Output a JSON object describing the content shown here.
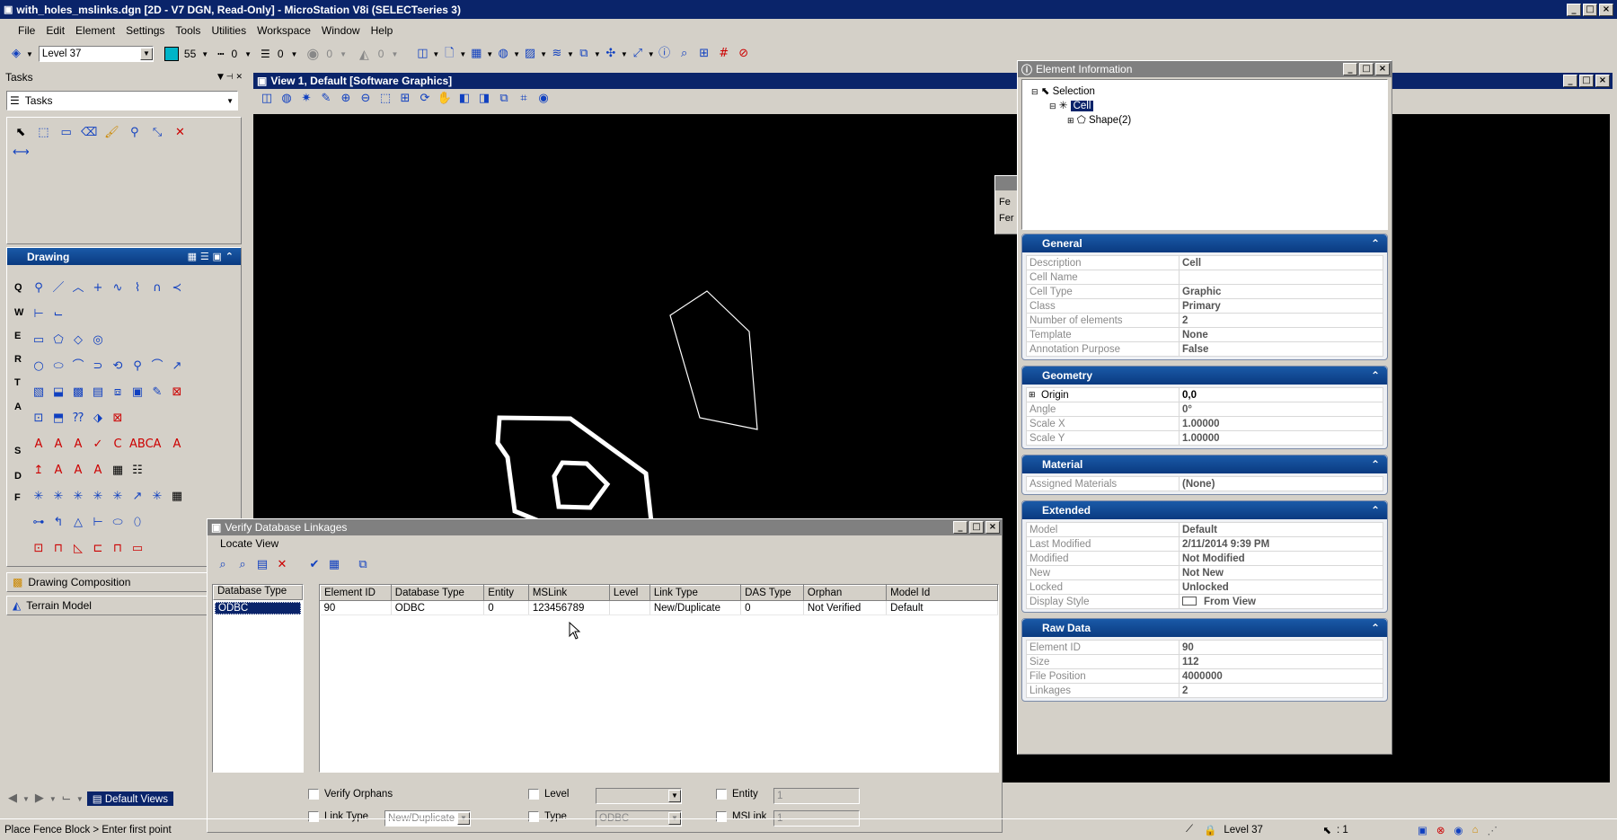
{
  "app": {
    "title": "with_holes_mslinks.dgn [2D - V7 DGN, Read-Only] - MicroStation V8i (SELECTseries 3)"
  },
  "menu": [
    "File",
    "Edit",
    "Element",
    "Settings",
    "Tools",
    "Utilities",
    "Workspace",
    "Window",
    "Help"
  ],
  "attributes": {
    "level": "Level 37",
    "color": "55",
    "style": "0",
    "weight": "0",
    "transp": "0",
    "priority": "0",
    "color_hex": "#00b4c8"
  },
  "tasks": {
    "title": "Tasks",
    "dropdown": "Tasks",
    "drawing_title": "Drawing",
    "drawing_comp": "Drawing Composition",
    "terrain": "Terrain Model",
    "row_letters": [
      "Q",
      "W",
      "E",
      "R",
      "T",
      "A",
      "S",
      "D",
      "F"
    ],
    "default_views": "Default Views"
  },
  "view": {
    "title": "View 1, Default [Software Graphics]"
  },
  "info": {
    "title": "Element Information",
    "tree": {
      "root": "Selection",
      "cell": "Cell",
      "shape": "Shape(2)"
    },
    "sections": [
      {
        "name": "General",
        "rows": [
          [
            "Description",
            "Cell"
          ],
          [
            "Cell Name",
            ""
          ],
          [
            "Cell Type",
            "Graphic"
          ],
          [
            "Class",
            "Primary"
          ],
          [
            "Number of elements",
            "2"
          ],
          [
            "Template",
            "None"
          ],
          [
            "Annotation Purpose",
            "False"
          ]
        ]
      },
      {
        "name": "Geometry",
        "rows": [
          [
            "Origin",
            "0,0"
          ],
          [
            "Angle",
            "0°"
          ],
          [
            "Scale X",
            "1.00000"
          ],
          [
            "Scale Y",
            "1.00000"
          ]
        ]
      },
      {
        "name": "Material",
        "rows": [
          [
            "Assigned Materials",
            "(None)"
          ]
        ]
      },
      {
        "name": "Extended",
        "rows": [
          [
            "Model",
            "Default"
          ],
          [
            "Last Modified",
            "2/11/2014 9:39 PM"
          ],
          [
            "Modified",
            "Not Modified"
          ],
          [
            "New",
            "Not New"
          ],
          [
            "Locked",
            "Unlocked"
          ],
          [
            "Display Style",
            "From View"
          ]
        ]
      },
      {
        "name": "Raw Data",
        "rows": [
          [
            "Element ID",
            "90"
          ],
          [
            "Size",
            "112"
          ],
          [
            "File Position",
            "4000000"
          ],
          [
            "Linkages",
            "2"
          ]
        ]
      }
    ]
  },
  "behind": {
    "l1": "Fe",
    "l2": "Fer"
  },
  "verify": {
    "title": "Verify Database Linkages",
    "menu": "Locate View",
    "left_header": "Database Type",
    "left_item": "ODBC",
    "columns": [
      "Element ID",
      "Database Type",
      "Entity",
      "MSLink",
      "Level",
      "Link Type",
      "DAS Type",
      "Orphan",
      "Model Id"
    ],
    "rows": [
      [
        "90",
        "ODBC",
        "0",
        "123456789",
        "",
        "New/Duplicate",
        "0",
        "Not Verified",
        "Default"
      ]
    ],
    "opts": {
      "verify_orphans": "Verify Orphans",
      "link_type": "Link Type",
      "link_type_val": "New/Duplicate",
      "level": "Level",
      "level_val": "",
      "type": "Type",
      "type_val": "ODBC",
      "entity": "Entity",
      "entity_val": "1",
      "mslink": "MSLink",
      "mslink_val": "1"
    }
  },
  "status": {
    "prompt": "Place Fence Block > Enter first point",
    "level": "Level 37",
    "scale": ": 1"
  }
}
